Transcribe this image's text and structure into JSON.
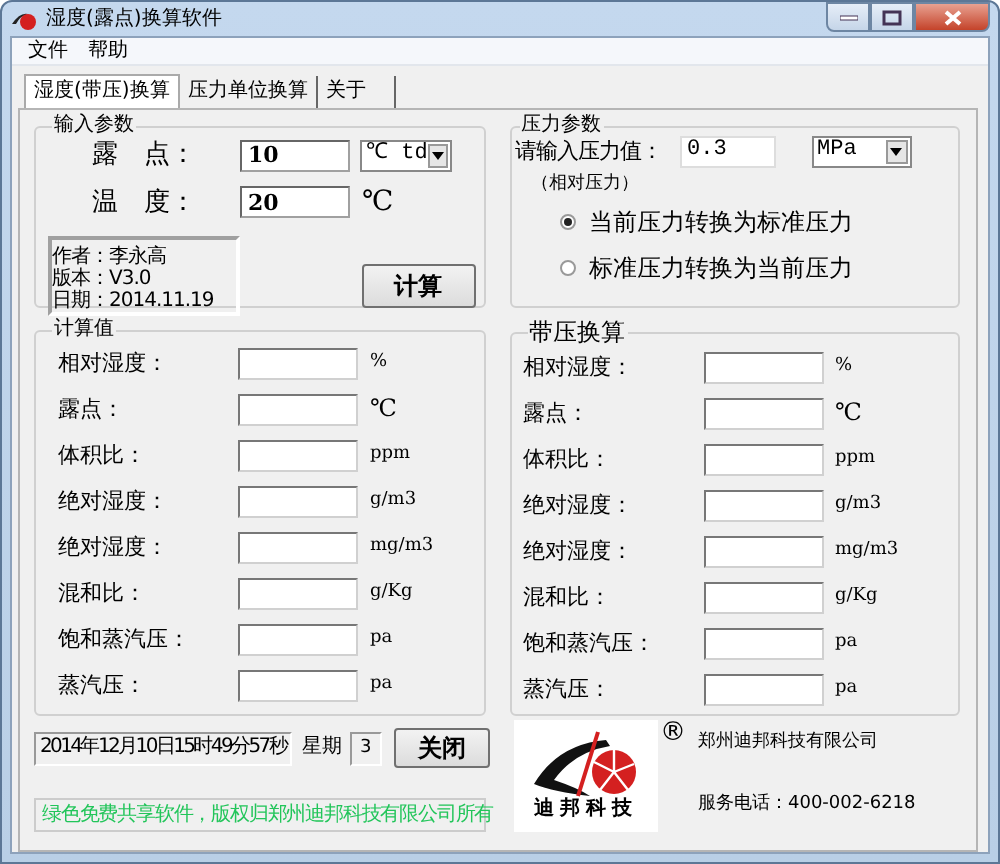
{
  "window": {
    "title": "湿度(露点)换算软件"
  },
  "menu": [
    "文件",
    "帮助"
  ],
  "tabs": [
    {
      "label": "湿度(带压)换算",
      "selected": true
    },
    {
      "label": "压力单位换算",
      "selected": false
    },
    {
      "label": "关于",
      "selected": false
    }
  ],
  "input_params": {
    "title": "输入参数",
    "fields": [
      {
        "label": "露　点：",
        "value": "10",
        "unit": "℃ td",
        "kind": "select"
      },
      {
        "label": "温　度：",
        "value": "20",
        "unit": "℃",
        "kind": "text"
      }
    ],
    "info": [
      "作者：李永高",
      "版本：V3.0",
      "日期：2014.11.19"
    ],
    "button": "计算"
  },
  "pressure_params": {
    "title": "压力参数",
    "label": "请输入压力值：",
    "value": "0.3",
    "unit": "MPa",
    "note": "（相对压力）",
    "options": [
      {
        "label": "当前压力转换为标准压力",
        "selected": true
      },
      {
        "label": "标准压力转换为当前压力",
        "selected": false
      }
    ]
  },
  "groups": [
    {
      "title": "计算值",
      "rows": [
        {
          "label": "相对湿度：",
          "unit": "%"
        },
        {
          "label": "露点：",
          "unit": "℃"
        },
        {
          "label": "体积比：",
          "unit": "ppm"
        },
        {
          "label": "绝对湿度：",
          "unit": "g/m3"
        },
        {
          "label": "绝对湿度：",
          "unit": "mg/m3"
        },
        {
          "label": "混和比：",
          "unit": "g/Kg"
        },
        {
          "label": "饱和蒸汽压：",
          "unit": "pa"
        },
        {
          "label": "蒸汽压：",
          "unit": "pa"
        }
      ]
    },
    {
      "title": "带压换算",
      "rows": [
        {
          "label": "相对湿度：",
          "unit": "%"
        },
        {
          "label": "露点：",
          "unit": "℃"
        },
        {
          "label": "体积比：",
          "unit": "ppm"
        },
        {
          "label": "绝对湿度：",
          "unit": "g/m3"
        },
        {
          "label": "绝对湿度：",
          "unit": "mg/m3"
        },
        {
          "label": "混和比：",
          "unit": "g/Kg"
        },
        {
          "label": "饱和蒸汽压：",
          "unit": "pa"
        },
        {
          "label": "蒸汽压：",
          "unit": "pa"
        }
      ]
    }
  ],
  "footer": {
    "datetime": "2014年12月10日15时49分57秒",
    "weekday_label": "星期",
    "weekday": "3",
    "close_button": "关闭",
    "logo_text": "迪邦科技",
    "logo_mark": "®",
    "company": "郑州迪邦科技有限公司",
    "phone": "服务电话：400-002-6218",
    "notice": "绿色免费共享软件，版权归郑州迪邦科技有限公司所有"
  }
}
